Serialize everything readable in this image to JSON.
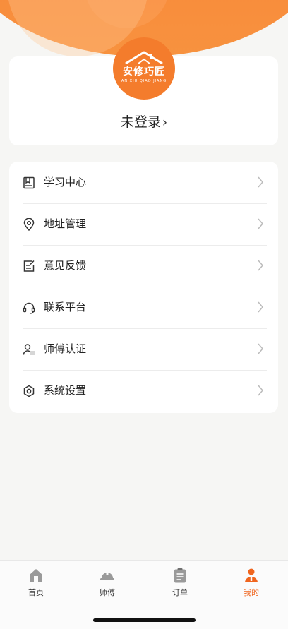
{
  "profile": {
    "logo_title": "安修巧匠",
    "logo_subtitle": "AN XIU QIAO JIANG",
    "login_status": "未登录",
    "login_arrow": "›"
  },
  "menu": {
    "items": [
      {
        "label": "学习中心",
        "icon": "book-icon"
      },
      {
        "label": "地址管理",
        "icon": "location-pin-icon"
      },
      {
        "label": "意见反馈",
        "icon": "edit-note-icon"
      },
      {
        "label": "联系平台",
        "icon": "headset-icon"
      },
      {
        "label": "师傅认证",
        "icon": "user-verify-icon"
      },
      {
        "label": "系统设置",
        "icon": "gear-icon"
      }
    ]
  },
  "tabbar": {
    "tabs": [
      {
        "label": "首页",
        "icon": "home-icon",
        "active": false
      },
      {
        "label": "师傅",
        "icon": "helmet-icon",
        "active": false
      },
      {
        "label": "订单",
        "icon": "clipboard-icon",
        "active": false
      },
      {
        "label": "我的",
        "icon": "person-icon",
        "active": true
      }
    ]
  },
  "colors": {
    "accent": "#f0651e",
    "header": "#f98a3a",
    "logo": "#f47c2c"
  }
}
